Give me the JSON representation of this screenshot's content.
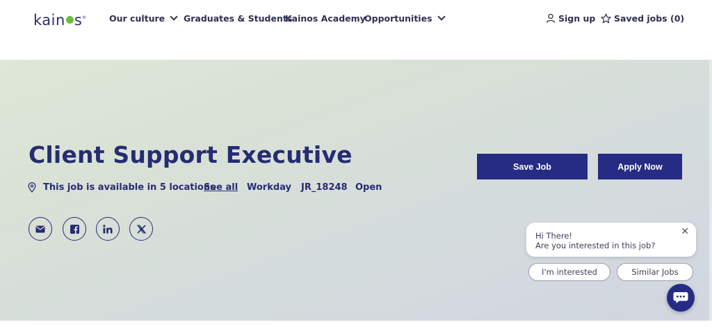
{
  "header": {
    "logo_text": "kainos",
    "nav": [
      {
        "label": "Our culture",
        "has_dropdown": true
      },
      {
        "label": "Graduates & Students",
        "has_dropdown": false
      },
      {
        "label": "Kainos Academy",
        "has_dropdown": false
      },
      {
        "label": "Opportunities",
        "has_dropdown": true
      }
    ],
    "sign_up_label": "Sign up",
    "saved_jobs_label": "Saved jobs (0)"
  },
  "job": {
    "title": "Client Support Executive",
    "locations_text": "This job is available in 5 locations",
    "see_all_label": "See all",
    "source": "Workday",
    "job_id": "JR_18248",
    "status": "Open"
  },
  "actions": {
    "save_label": "Save Job",
    "apply_label": "Apply Now"
  },
  "share_icons": [
    "email-icon",
    "facebook-icon",
    "linkedin-icon",
    "x-icon"
  ],
  "chat": {
    "greeting_line1": "Hi There!",
    "greeting_line2": "Are you interested in this job?",
    "interested_label": "I'm interested",
    "similar_label": "Similar Jobs"
  },
  "colors": {
    "brand_navy": "#262c84",
    "logo_dot_green": "#6ebf3f"
  }
}
